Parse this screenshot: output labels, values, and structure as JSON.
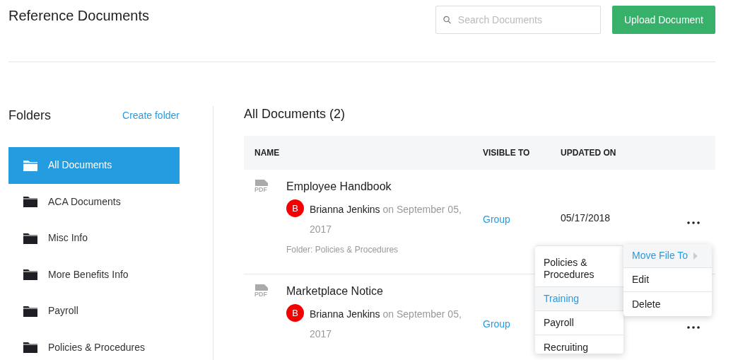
{
  "page": {
    "title": "Reference Documents"
  },
  "search": {
    "placeholder": "Search Documents"
  },
  "upload_button": "Upload Document",
  "sidebar": {
    "title": "Folders",
    "create_link": "Create folder",
    "items": [
      {
        "label": "All Documents",
        "selected": true
      },
      {
        "label": "ACA Documents",
        "selected": false
      },
      {
        "label": "Misc Info",
        "selected": false
      },
      {
        "label": "More Benefits Info",
        "selected": false
      },
      {
        "label": "Payroll",
        "selected": false
      },
      {
        "label": "Policies & Procedures",
        "selected": false
      }
    ]
  },
  "main": {
    "title": "All Documents (2)",
    "table": {
      "columns": [
        "NAME",
        "VISIBLE TO",
        "UPDATED ON"
      ],
      "rows": [
        {
          "name": "Employee Handbook",
          "file_type": "PDF",
          "avatar": "B",
          "author": "Brianna Jenkins",
          "date_text": "on September 05, 2017",
          "folder": "Folder: Policies & Procedures",
          "visible_to": "Group",
          "updated_on": "05/17/2018"
        },
        {
          "name": "Marketplace Notice",
          "file_type": "PDF",
          "avatar": "B",
          "author": "Brianna Jenkins",
          "date_text": "on September 05, 2017",
          "visible_to": "Group"
        }
      ]
    }
  },
  "context_menu": {
    "items": [
      {
        "label": "Move File To",
        "selected": true,
        "submenu": true
      },
      {
        "label": "Edit",
        "selected": false,
        "submenu": false
      },
      {
        "label": "Delete",
        "selected": false,
        "submenu": false
      }
    ]
  },
  "submenu": {
    "items": [
      {
        "label": "Policies & Procedures",
        "selected": false
      },
      {
        "label": "Training",
        "selected": true
      },
      {
        "label": "Payroll",
        "selected": false
      },
      {
        "label": "Recruiting",
        "selected": false
      }
    ]
  }
}
